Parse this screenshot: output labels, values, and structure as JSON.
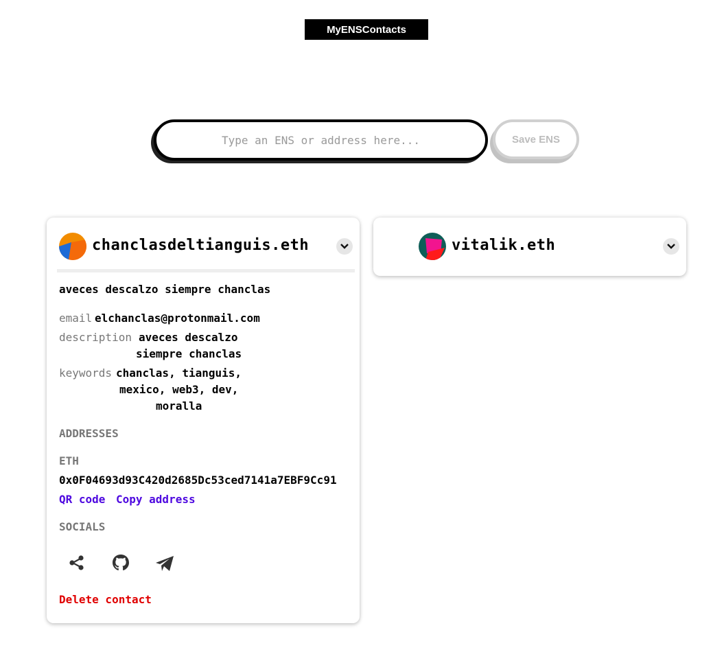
{
  "header": {
    "brand": "MyENSContacts"
  },
  "search": {
    "placeholder": "Type an ENS or address here...",
    "save_label": "Save ENS"
  },
  "contacts": [
    {
      "name": "chanclasdeltianguis.eth",
      "bio": "aveces descalzo siempre chanclas",
      "email_label": "email",
      "email": "elchanclas@protonmail.com",
      "description_label": "description",
      "description_line1": "aveces descalzo",
      "description_line2": "siempre chanclas",
      "keywords_label": "keywords",
      "keywords_line1": "chanclas, tianguis,",
      "keywords_line2": "mexico, web3, dev,",
      "keywords_line3": "moralla",
      "addresses_heading": "ADDRESSES",
      "eth_label": "ETH",
      "eth_address": "0x0F04693d93C420d2685Dc53ced7141a7EBF9Cc91",
      "qr_label": "QR code",
      "copy_label": "Copy address",
      "socials_heading": "SOCIALS",
      "socials": [
        "share-icon",
        "github-icon",
        "telegram-icon"
      ],
      "delete_label": "Delete contact"
    },
    {
      "name": "vitalik.eth"
    }
  ],
  "colors": {
    "link": "#4f0ae0",
    "danger": "#e00000",
    "muted": "#777777"
  }
}
